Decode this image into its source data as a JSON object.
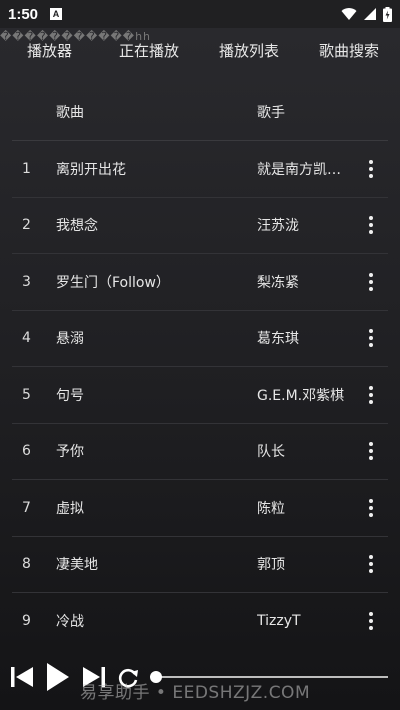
{
  "status_bar": {
    "time": "1:50",
    "notification_glyph": "A"
  },
  "overlay_text": "�����������hh",
  "tabs": [
    {
      "label": "播放器"
    },
    {
      "label": "正在播放"
    },
    {
      "label": "播放列表"
    },
    {
      "label": "歌曲搜索"
    }
  ],
  "table": {
    "headers": {
      "title": "歌曲",
      "artist": "歌手"
    },
    "rows": [
      {
        "index": "1",
        "title": "离别开出花",
        "artist": "就是南方凯…"
      },
      {
        "index": "2",
        "title": "我想念",
        "artist": "汪苏泷"
      },
      {
        "index": "3",
        "title": "罗生门（Follow）",
        "artist": "梨冻紧"
      },
      {
        "index": "4",
        "title": "悬溺",
        "artist": "葛东琪"
      },
      {
        "index": "5",
        "title": "句号",
        "artist": "G.E.M.邓紫棋"
      },
      {
        "index": "6",
        "title": "予你",
        "artist": "队长"
      },
      {
        "index": "7",
        "title": "虚拟",
        "artist": "陈粒"
      },
      {
        "index": "8",
        "title": "凄美地",
        "artist": "郭顶"
      },
      {
        "index": "9",
        "title": "冷战",
        "artist": "TizzyT"
      }
    ]
  },
  "player": {
    "progress": 0.0
  },
  "watermark": "易享助手 • EEDSHZJZ.COM"
}
